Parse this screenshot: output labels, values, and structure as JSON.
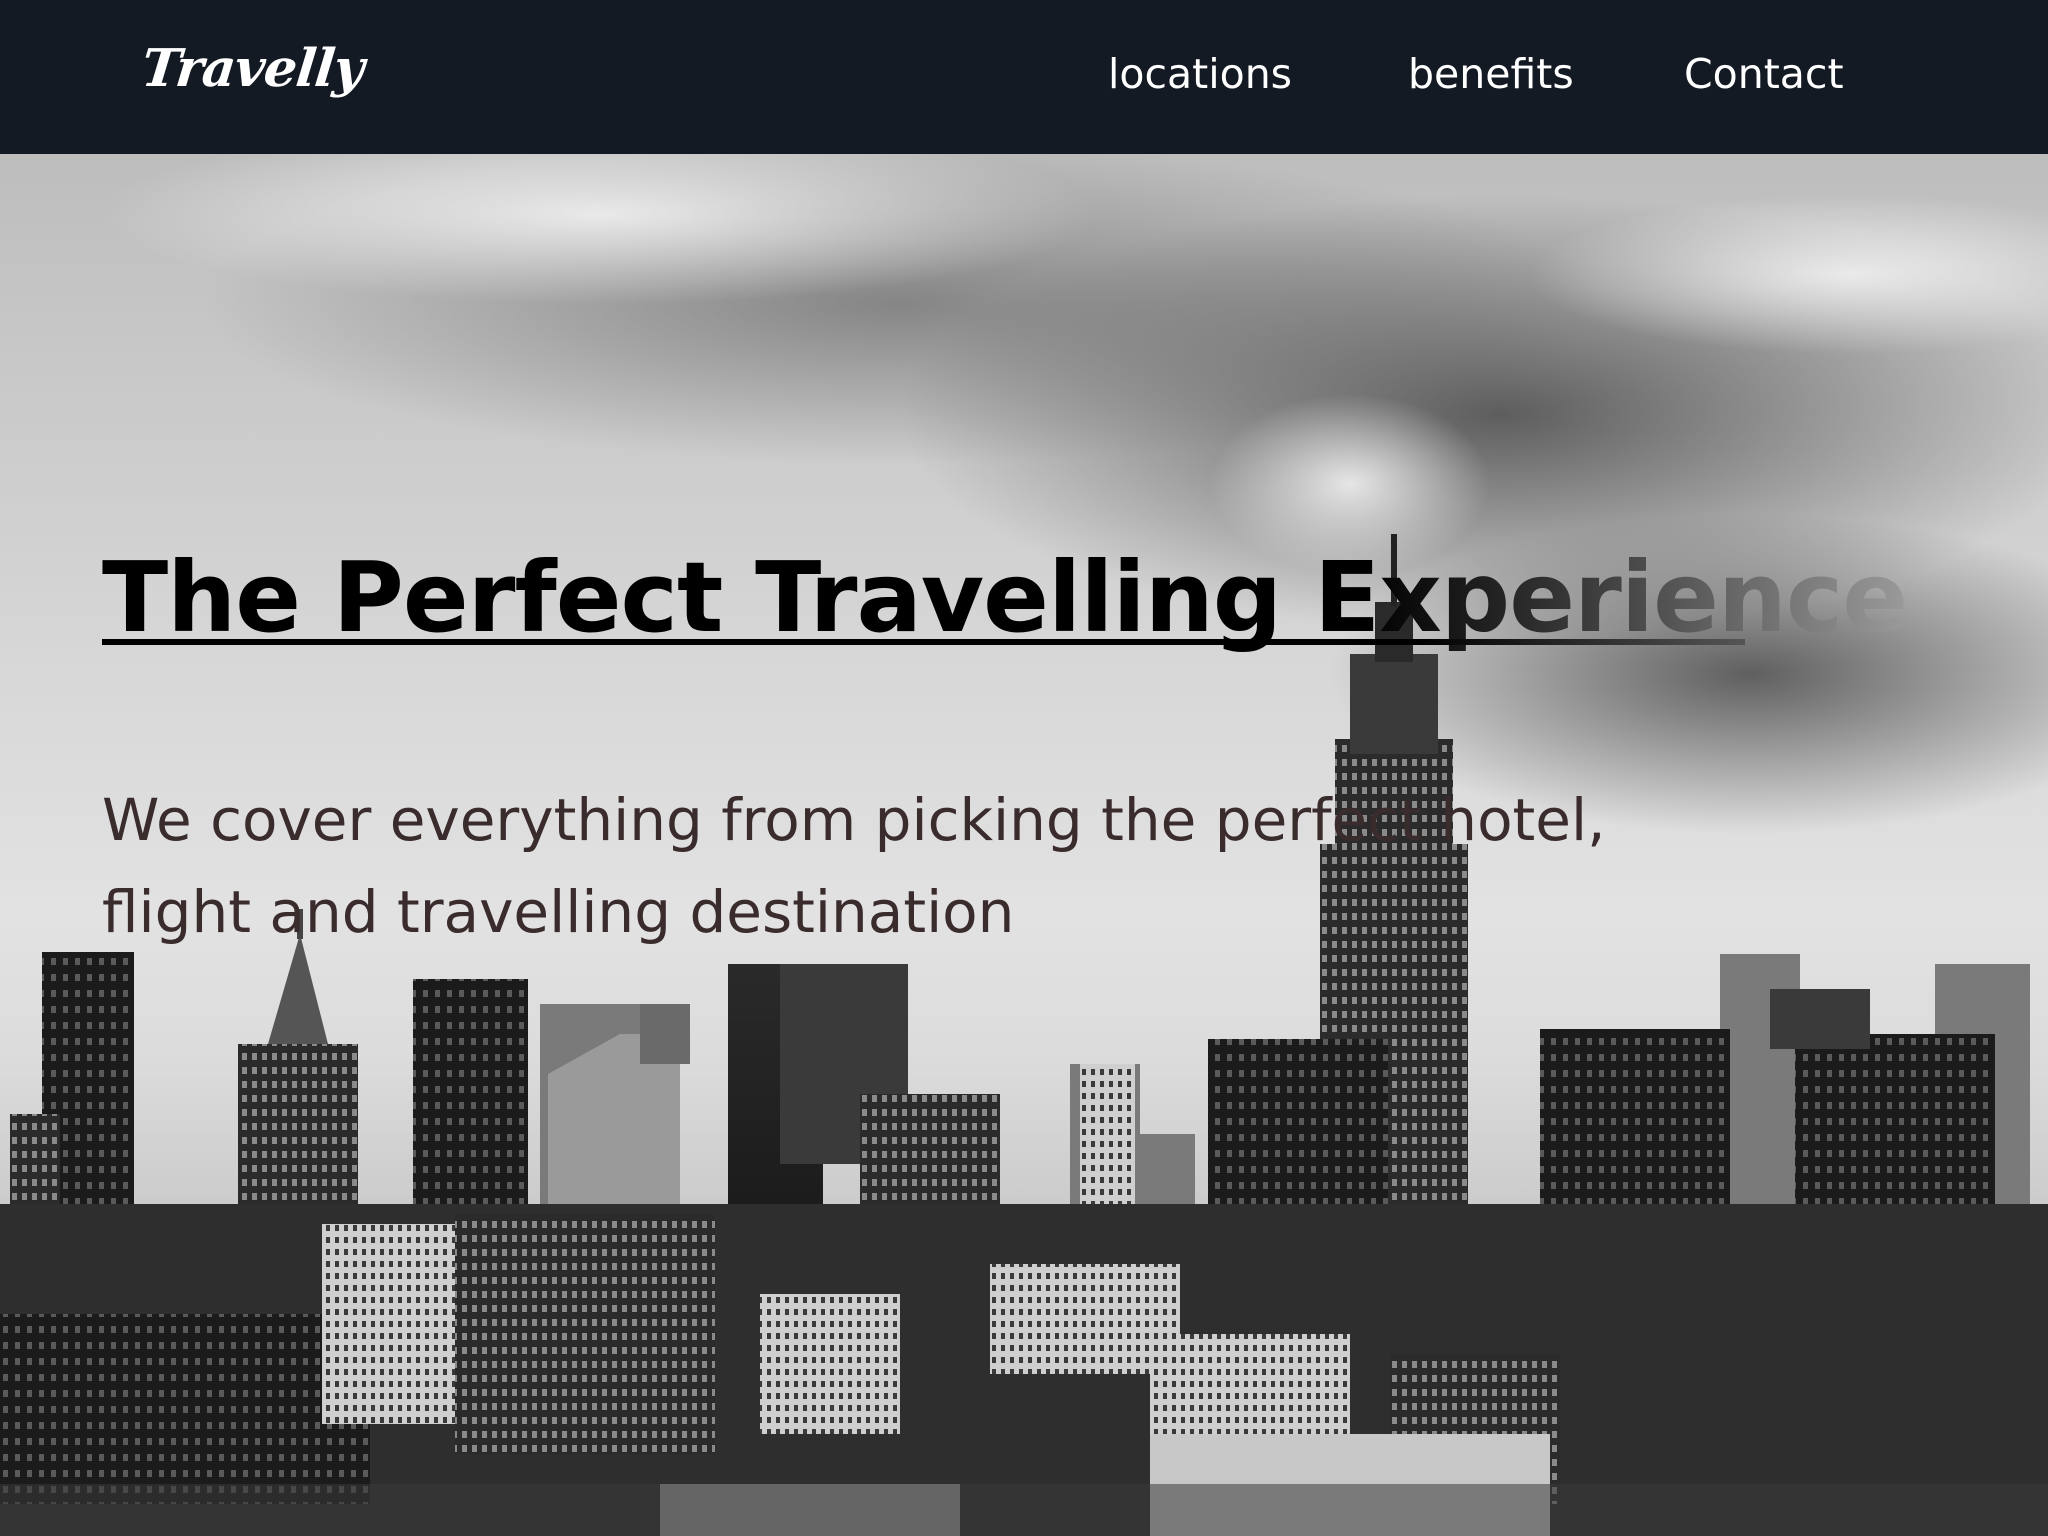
{
  "brand": {
    "name": "Travelly"
  },
  "nav": {
    "items": [
      {
        "label": "locations"
      },
      {
        "label": "benefits"
      },
      {
        "label": "Contact"
      }
    ]
  },
  "hero": {
    "title": "The Perfect Travelling Experience",
    "subtitle_line1": "We cover everything from picking the perfect hotel,",
    "subtitle_line2": "flight and travelling destination",
    "background": "black-and-white city skyline photo with cloudy sky"
  },
  "colors": {
    "navbar_bg": "#141a24",
    "nav_text": "#ffffff",
    "title_text": "#000000",
    "subtitle_text": "#3a2b2d"
  }
}
